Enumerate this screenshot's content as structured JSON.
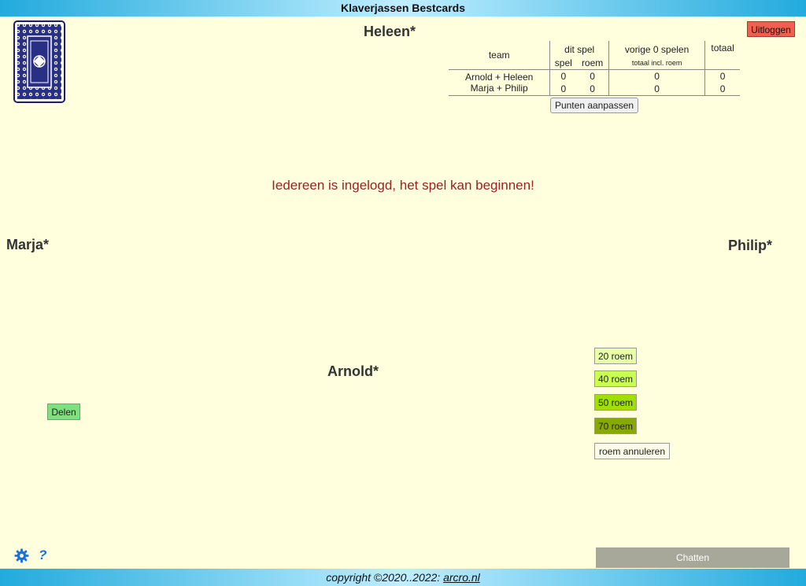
{
  "title": "Klaverjassen Bestcards",
  "logout_label": "Uitloggen",
  "players": {
    "top": "Heleen*",
    "left": "Marja*",
    "right": "Philip*",
    "bottom": "Arnold*"
  },
  "score_table": {
    "col_team": "team",
    "col_dit_spel": "dit spel",
    "col_spel": "spel",
    "col_roem": "roem",
    "col_vorige": "vorige 0 spelen",
    "col_totaal_incl": "totaal incl. roem",
    "col_totaal": "totaal",
    "rows": [
      {
        "team": "Arnold + Heleen",
        "spel": "0",
        "roem": "0",
        "vorige": "0",
        "totaal": "0"
      },
      {
        "team": "Marja + Philip",
        "spel": "0",
        "roem": "0",
        "vorige": "0",
        "totaal": "0"
      }
    ],
    "adjust_label": "Punten aanpassen"
  },
  "message": "Iedereen is ingelogd, het spel kan beginnen!",
  "roem_buttons": {
    "r20": "20 roem",
    "r40": "40 roem",
    "r50": "50 roem",
    "r70": "70 roem",
    "cancel": "roem annuleren"
  },
  "deal_label": "Delen",
  "chat_label": "Chatten",
  "help_label": "?",
  "footer": {
    "prefix": "copyright ©2020..2022: ",
    "link": "arcro.nl"
  },
  "colors": {
    "background": "#ffffdd",
    "header_gradient": "#22aadd",
    "message": "#992222",
    "logout": "#f06050",
    "roem20": "#e8ffa8",
    "roem40": "#c8ff50",
    "roem50": "#a0e000",
    "roem70": "#88aa00"
  },
  "icons": [
    "card-back-icon",
    "gear-icon",
    "help-icon"
  ]
}
